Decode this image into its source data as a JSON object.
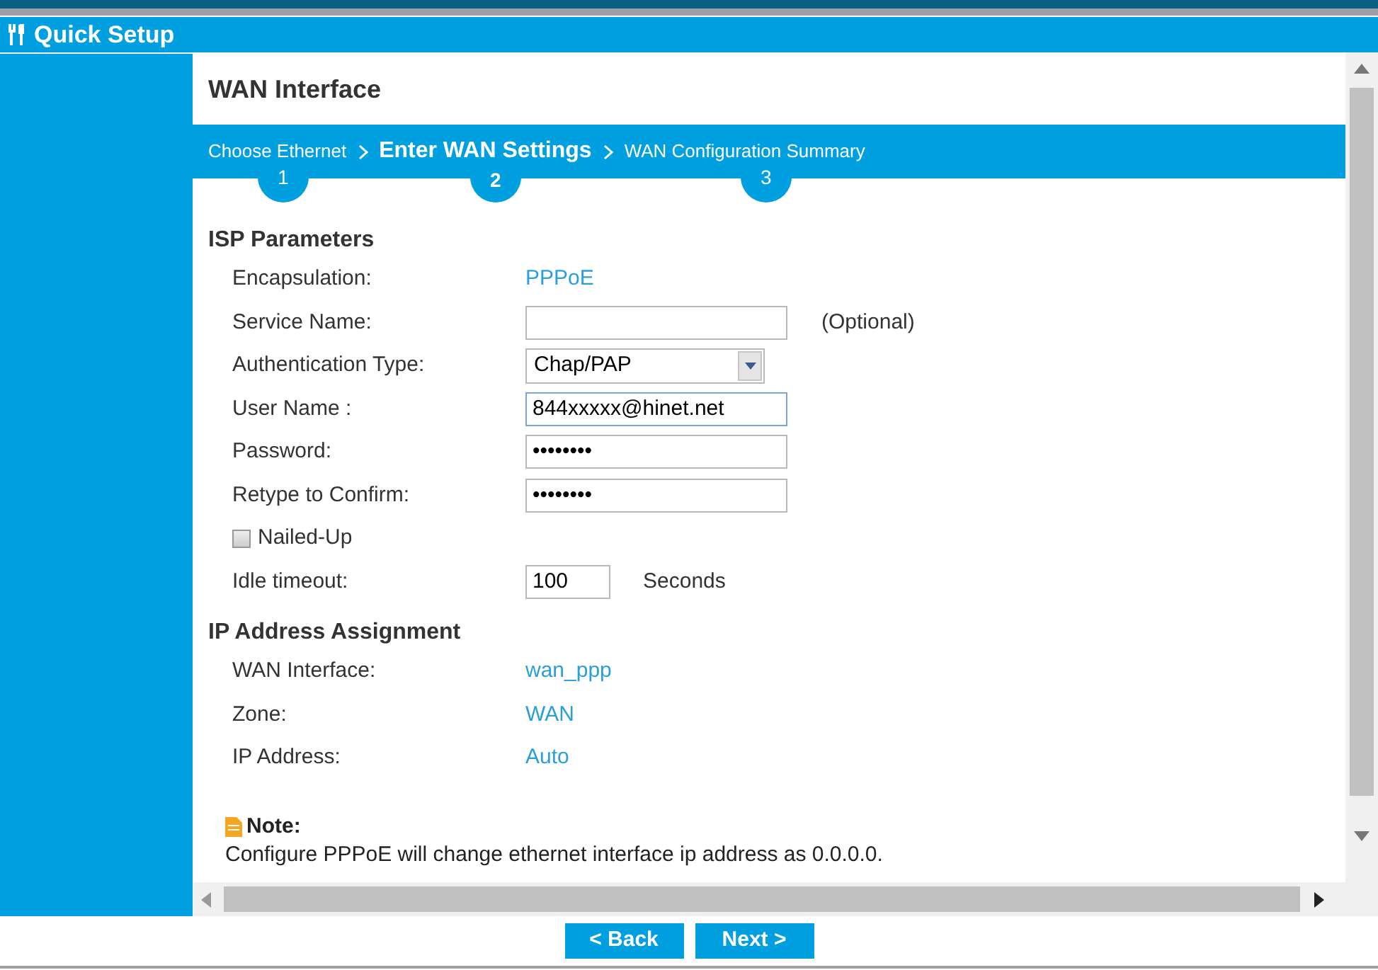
{
  "window": {
    "title": "Quick Setup"
  },
  "page_title": "WAN Interface",
  "steps": [
    {
      "label": "Choose Ethernet",
      "number": "1",
      "selected": false
    },
    {
      "label": "Enter WAN Settings",
      "number": "2",
      "selected": true
    },
    {
      "label": "WAN Configuration Summary",
      "number": "3",
      "selected": false
    }
  ],
  "isp_section": {
    "title": "ISP Parameters",
    "rows": [
      {
        "kind": "value",
        "label": "Encapsulation:",
        "value": "PPPoE"
      },
      {
        "kind": "input",
        "label": "Service Name:",
        "hint": "(Optional)"
      },
      {
        "kind": "select",
        "label": "Authentication Type:",
        "value": "Chap/PAP"
      },
      {
        "kind": "input",
        "label": "User Name :",
        "value": "844xxxxx@hinet.net",
        "focused": true
      },
      {
        "kind": "input",
        "label": "Password:",
        "value": "••••••••"
      },
      {
        "kind": "input",
        "label": "Retype to Confirm:",
        "value": "••••••••"
      },
      {
        "kind": "checkbox",
        "label": "Nailed-Up",
        "checked": false
      },
      {
        "kind": "short_input",
        "label": "Idle timeout:",
        "value": "100",
        "unit": "Seconds"
      }
    ]
  },
  "ip_section": {
    "title": "IP Address Assignment",
    "rows": [
      {
        "kind": "value",
        "label": "WAN Interface:",
        "value": "wan_ppp"
      },
      {
        "kind": "value",
        "label": "Zone:",
        "value": "WAN"
      },
      {
        "kind": "value",
        "label": "IP Address:",
        "value": "Auto"
      }
    ]
  },
  "note": {
    "title": "Note:",
    "text": "Configure PPPoE will change ethernet interface ip address as 0.0.0.0."
  },
  "buttons": [
    "< Back",
    "Next >"
  ]
}
